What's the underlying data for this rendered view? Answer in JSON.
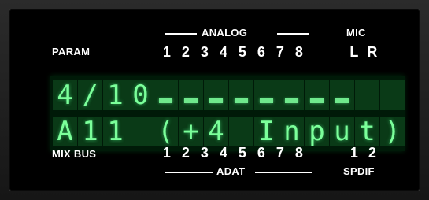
{
  "header": {
    "param_label": "PARAM",
    "analog_label": "ANALOG",
    "mic_label": "MIC"
  },
  "top_channels": [
    "1",
    "2",
    "3",
    "4",
    "5",
    "6",
    "7",
    "8"
  ],
  "mic_channels": [
    "L",
    "R"
  ],
  "lcd": {
    "row1": [
      "4",
      "/",
      "1",
      "0",
      "",
      "",
      "",
      "",
      "",
      "",
      "",
      "",
      "",
      ""
    ],
    "row2": [
      "A",
      "1",
      "1",
      "",
      "(",
      "+",
      "4",
      "",
      "I",
      "n",
      "p",
      "u",
      "t",
      ")"
    ],
    "meters_on_cells": [
      4,
      5,
      6,
      7,
      8,
      9,
      10,
      11
    ]
  },
  "footer": {
    "mix_bus_label": "MIX BUS",
    "adat_label": "ADAT",
    "spdif_label": "SPDIF"
  },
  "bottom_channels": [
    "1",
    "2",
    "3",
    "4",
    "5",
    "6",
    "7",
    "8"
  ],
  "spdif_channels": [
    "1",
    "2"
  ],
  "colors": {
    "lcd_text": "#7bff9a",
    "lcd_cell": "#0a3a17",
    "label": "#ffffff",
    "panel": "#000000"
  }
}
